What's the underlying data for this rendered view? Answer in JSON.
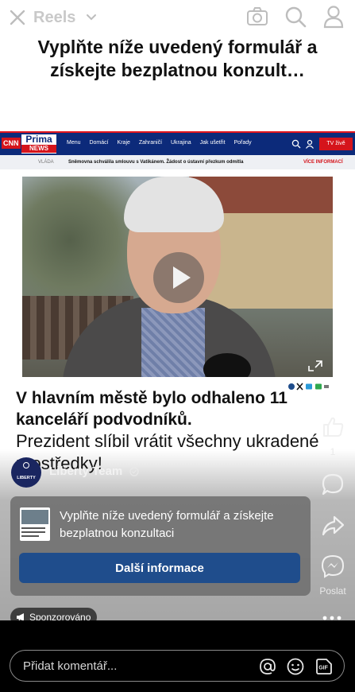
{
  "top_bar": {
    "title": "Reels",
    "headline": "Vyplňte níže uvedený formulář a získejte bezplatnou konzult…"
  },
  "news_site": {
    "logo_cnn": "CNN",
    "logo_prima": "Prima",
    "logo_news": "NEWS",
    "nav_items": [
      "Menu",
      "Domácí",
      "Kraje",
      "Zahraničí",
      "Ukrajina",
      "Jak ušetřit",
      "Pořady"
    ],
    "tv_button": "TV živě",
    "ticker_tag": "VLÁDA",
    "ticker_text": "Sněmovna schválila smlouvu s Vatikánem. Žádost o ústavní přezkum odmítla",
    "ticker_more": "VÍCE INFORMACÍ",
    "headline_1": "V hlavním městě bylo odhaleno 11 kanceláří podvodníků.",
    "headline_2": "Prezident slíbil vrátit všechny ukradené prostředky!"
  },
  "author": {
    "avatar_text": "LIBERTY",
    "name": "Liberty Team"
  },
  "ad_card": {
    "text": "Vyplňte níže uvedený formulář a získejte bezplatnou konzultaci",
    "cta": "Další informace"
  },
  "rail": {
    "like_count": "1",
    "share_label": "Poslat"
  },
  "sponsored": "Sponzorováno",
  "comment": {
    "placeholder": "Přidat komentář..."
  },
  "colors": {
    "cta_blue": "#1f4d8c",
    "news_navy": "#0c2a7a",
    "news_red": "#d5141b"
  }
}
